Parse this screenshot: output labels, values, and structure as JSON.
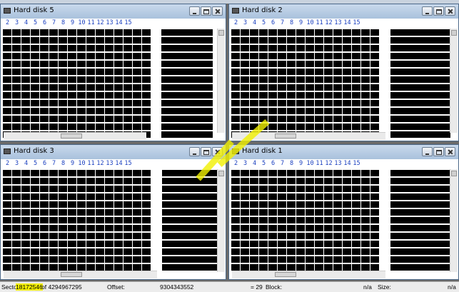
{
  "windows": [
    {
      "title": "Hard disk 5"
    },
    {
      "title": "Hard disk 2"
    },
    {
      "title": "Hard disk 3"
    },
    {
      "title": "Hard disk 1"
    }
  ],
  "columns": [
    "2",
    "3",
    "4",
    "5",
    "6",
    "7",
    "8",
    "9",
    "10",
    "11",
    "12",
    "13",
    "14",
    "15"
  ],
  "status": {
    "sector_label": "Sector",
    "sector_value": "18172546",
    "sector_of": "of 4294967295",
    "offset_label": "Offset:",
    "offset_value": "9304343552",
    "eq": "= 29",
    "block_label": "Block:",
    "block_value": "n/a",
    "size_label": "Size:",
    "size_value": "n/a"
  },
  "colors": {
    "title_gradient_top": "#c9d9ec",
    "column_header": "#1a3fbf",
    "highlight": "#f4f000"
  },
  "icons": [
    "minimize-icon",
    "maximize-icon",
    "close-icon",
    "app-icon"
  ]
}
